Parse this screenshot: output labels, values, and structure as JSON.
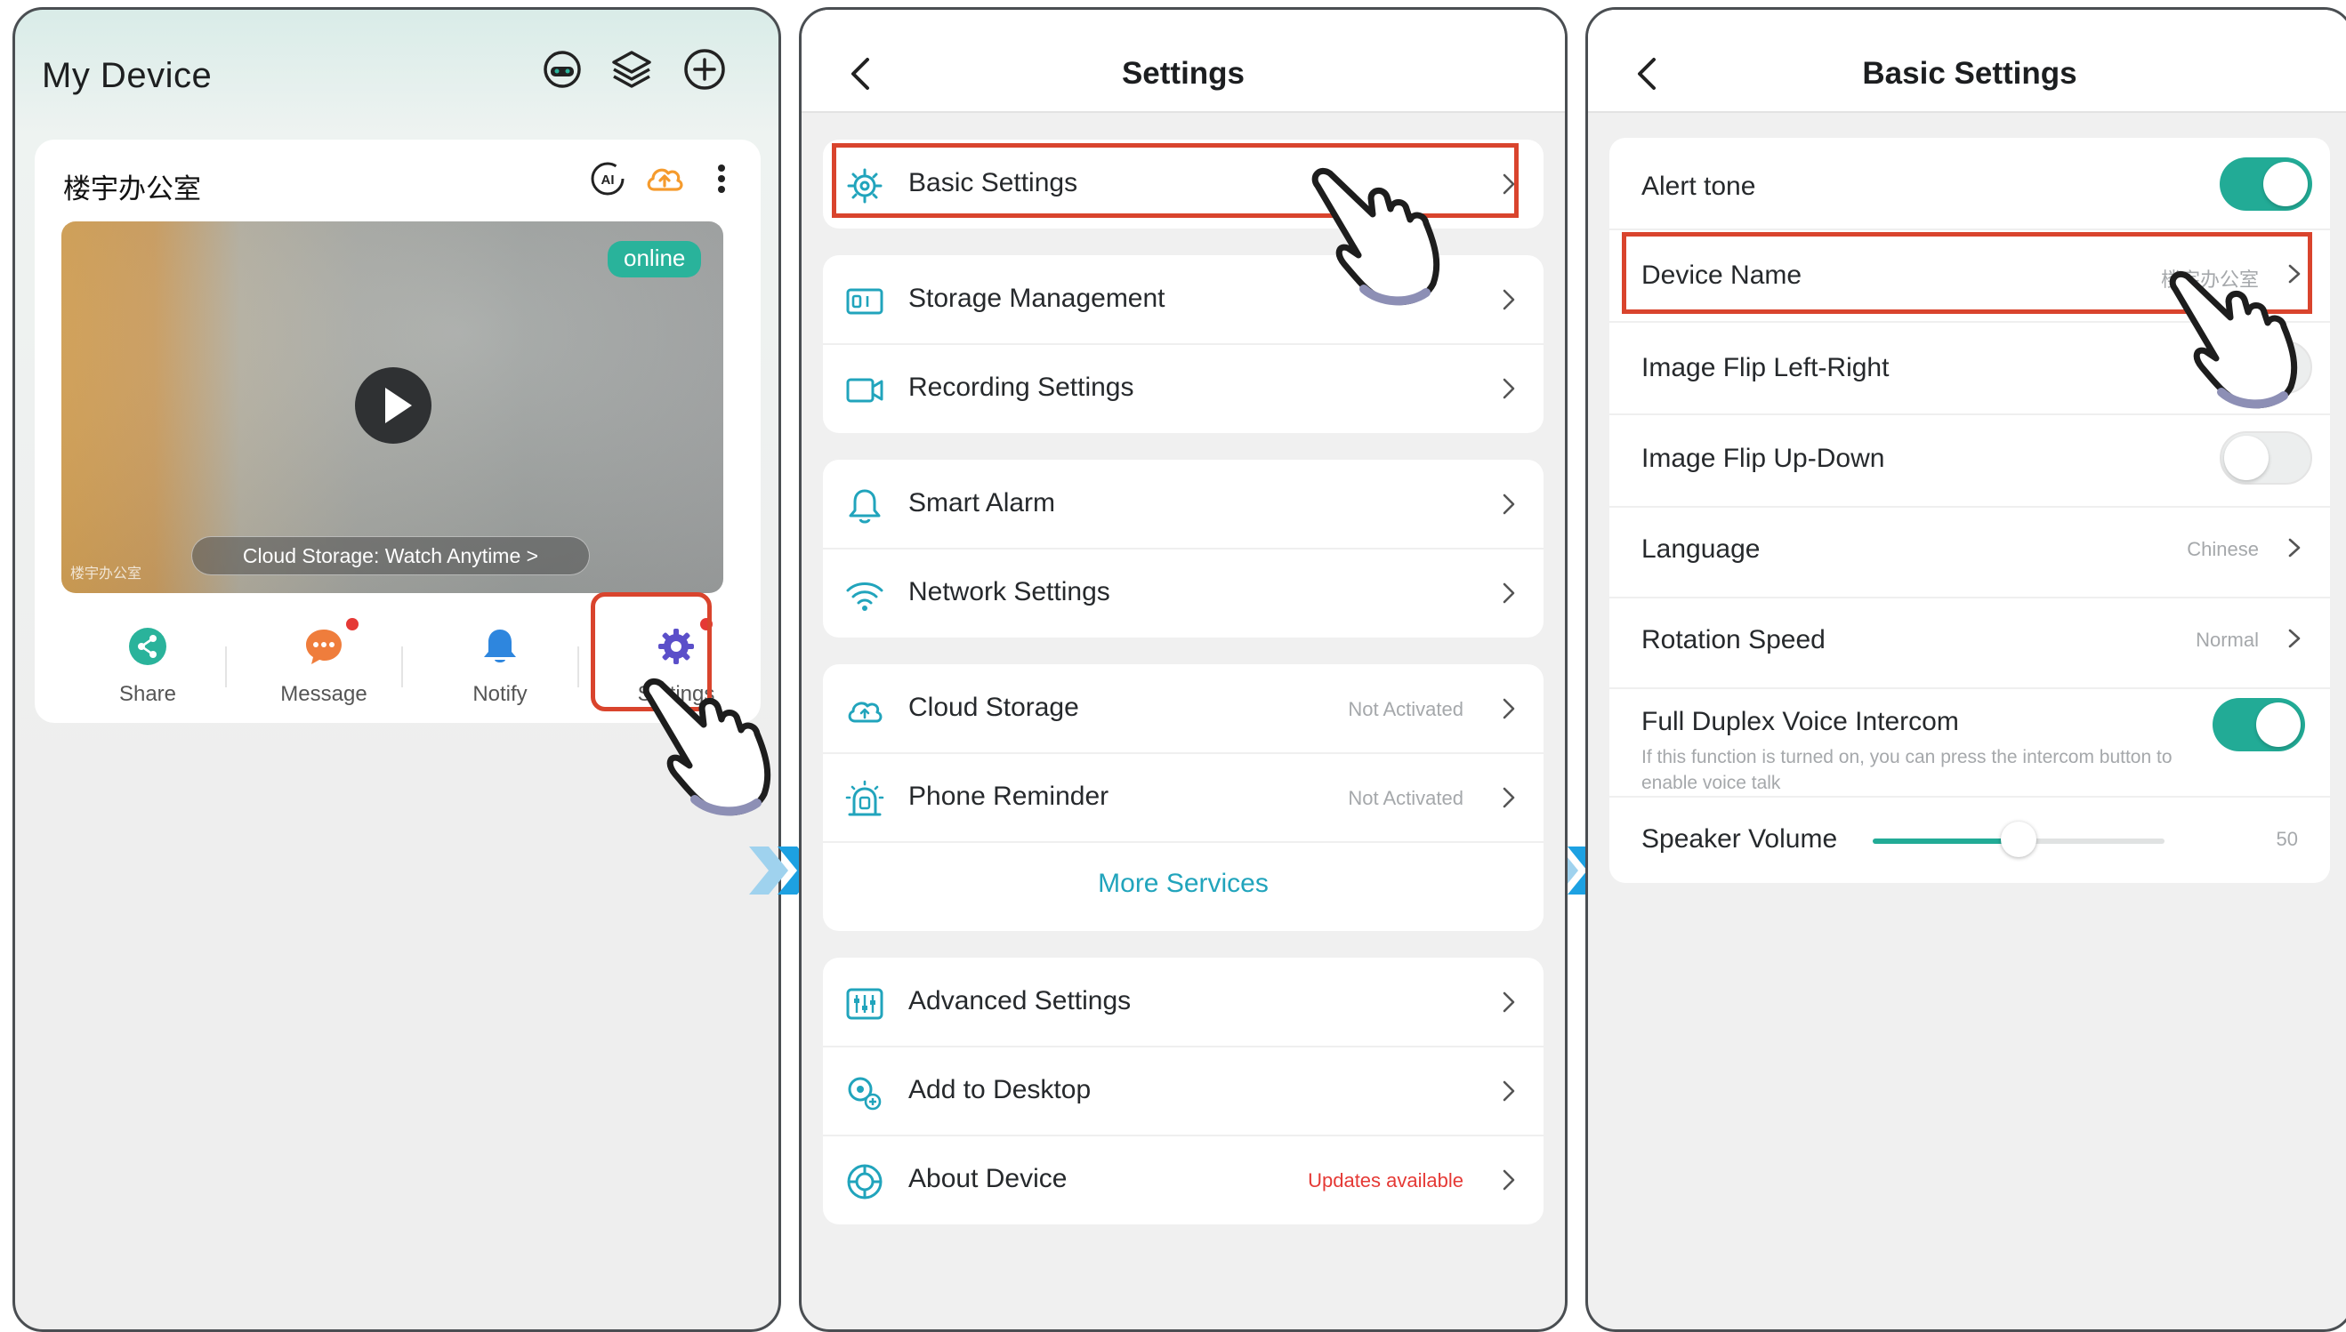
{
  "colors": {
    "accent": "#22ab96",
    "link": "#21a4bc",
    "highlight": "#d9442d",
    "alert": "#e53935",
    "warn_orange": "#f59b2d"
  },
  "panel1": {
    "title": "My Device",
    "header_icons": [
      "headset-icon",
      "layers-icon",
      "add-circle-icon"
    ],
    "card": {
      "name": "楼宇办公室",
      "icons": [
        "ai-icon",
        "cloud-upload-icon",
        "more-vert-icon"
      ],
      "status": "online",
      "cloud_banner": "Cloud Storage: Watch Anytime >",
      "watermark": "楼宇办公室",
      "actions": [
        {
          "label": "Share",
          "icon": "share-icon"
        },
        {
          "label": "Message",
          "icon": "message-icon"
        },
        {
          "label": "Notify",
          "icon": "bell-icon"
        },
        {
          "label": "Settings",
          "icon": "gear-icon"
        }
      ]
    }
  },
  "panel2": {
    "title": "Settings",
    "rows": [
      {
        "label": "Basic Settings",
        "icon": "gear-icon"
      },
      {
        "label": "Storage Management",
        "icon": "storage-icon"
      },
      {
        "label": "Recording Settings",
        "icon": "video-record-icon"
      },
      {
        "label": "Smart Alarm",
        "icon": "bell-icon"
      },
      {
        "label": "Network Settings",
        "icon": "wifi-icon"
      },
      {
        "label": "Cloud Storage",
        "icon": "cloud-icon",
        "value": "Not Activated"
      },
      {
        "label": "Phone Reminder",
        "icon": "phone-alarm-icon",
        "value": "Not Activated"
      },
      {
        "label": "Advanced Settings",
        "icon": "sliders-icon"
      },
      {
        "label": "Add to Desktop",
        "icon": "add-desktop-icon"
      },
      {
        "label": "About Device",
        "icon": "info-icon",
        "value": "Updates available"
      }
    ],
    "more_services": "More Services"
  },
  "panel3": {
    "title": "Basic Settings",
    "alert_tone": {
      "label": "Alert tone",
      "on": true
    },
    "device_name": {
      "label": "Device Name",
      "value": "楼宇办公室"
    },
    "flip_lr": {
      "label": "Image Flip Left-Right",
      "on": false
    },
    "flip_ud": {
      "label": "Image Flip Up-Down",
      "on": false
    },
    "language": {
      "label": "Language",
      "value": "Chinese"
    },
    "rotation": {
      "label": "Rotation Speed",
      "value": "Normal"
    },
    "duplex": {
      "label": "Full Duplex Voice Intercom",
      "on": true,
      "desc": "If this function is turned on, you can press the intercom button to enable voice talk"
    },
    "volume": {
      "label": "Speaker Volume",
      "value": 50
    }
  }
}
